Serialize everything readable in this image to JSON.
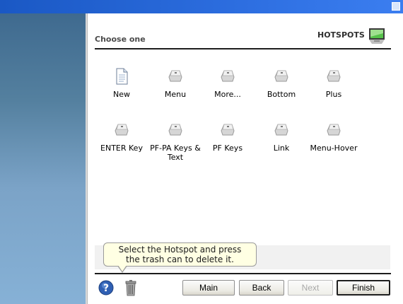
{
  "window": {
    "title": ""
  },
  "header": {
    "label": "Choose one",
    "section": "HOTSPOTS",
    "icon": "hotspots-monitor-icon"
  },
  "items": [
    {
      "label": "New",
      "icon": "new-document-icon"
    },
    {
      "label": "Menu",
      "icon": "key-icon"
    },
    {
      "label": "More...",
      "icon": "key-icon"
    },
    {
      "label": "Bottom",
      "icon": "key-icon"
    },
    {
      "label": "Plus",
      "icon": "key-icon"
    },
    {
      "label": "ENTER Key",
      "icon": "key-icon"
    },
    {
      "label": "PF-PA Keys & Text",
      "icon": "key-icon"
    },
    {
      "label": "PF Keys",
      "icon": "key-icon"
    },
    {
      "label": "Link",
      "icon": "key-icon"
    },
    {
      "label": "Menu-Hover",
      "icon": "key-icon"
    }
  ],
  "tooltip": {
    "line1": "Select the Hotspot and press",
    "line2": "the trash can to delete it."
  },
  "footer": {
    "help_icon": "help-icon",
    "trash_icon": "trash-icon",
    "buttons": {
      "main": "Main",
      "back": "Back",
      "next": "Next",
      "finish": "Finish"
    }
  },
  "colors": {
    "titlebar": "#2d6ee0",
    "sidebar_top": "#3f6a8f",
    "sidebar_bottom": "#86b1d6",
    "tooltip_bg": "#ffffe3"
  }
}
